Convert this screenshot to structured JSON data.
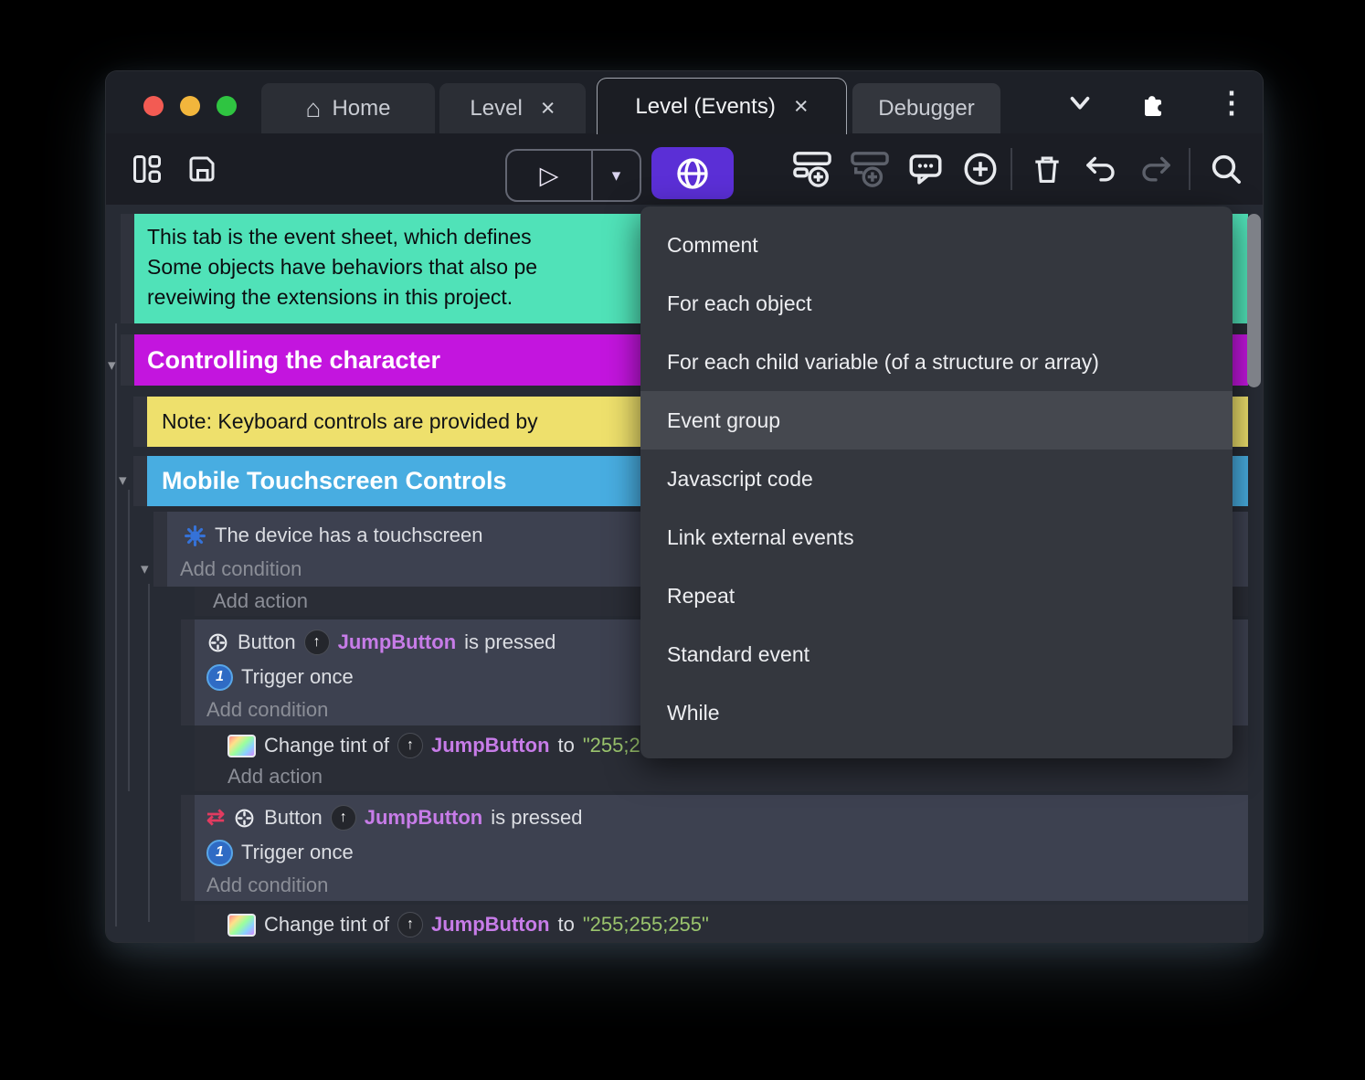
{
  "colors": {
    "accent_purple": "#5b2fd6",
    "comment_bg": "#50e2b8",
    "group_controlling_bg": "#c315de",
    "note_bg": "#eee06c",
    "group_mobile_bg": "#48ade1",
    "object_name": "#c77ce8",
    "string_value": "#9ac46d",
    "condition_block_bg": "#3d4150",
    "action_row_bg": "#2a2d36",
    "menu_bg": "#34373e",
    "menu_highlight_bg": "#45484f",
    "traffic_red": "#f35b53",
    "traffic_yellow": "#f2b63c",
    "traffic_green": "#2fc441"
  },
  "icons": {
    "house": "⌂",
    "play": "▷",
    "caret_down": "▾",
    "kebab": "⋮",
    "invert": "⇄",
    "object_arrow": "↑",
    "trigger_once_digit": "1",
    "collapse_arrow": "▾"
  },
  "titlebar": {
    "tabs": {
      "home": "Home",
      "level": "Level",
      "events": "Level (Events)",
      "debugger": "Debugger"
    },
    "close_glyph": "×"
  },
  "menu": {
    "items": [
      "Comment",
      "For each object",
      "For each child variable (of a structure or array)",
      "Event group",
      "Javascript code",
      "Link external events",
      "Repeat",
      "Standard event",
      "While"
    ],
    "highlighted_item": "Event group"
  },
  "sheet": {
    "comment_l1": "This tab is the event sheet, which defines",
    "comment_l2": "Some objects have behaviors that also pe",
    "comment_l3": "reveiwing the extensions in this project.",
    "group_controlling": "Controlling the character",
    "note": "Note: Keyboard controls are provided by",
    "group_mobile": "Mobile Touchscreen Controls",
    "device_condition": "The device has a touchscreen",
    "add_condition": "Add condition",
    "add_action": "Add action",
    "button_label": "Button",
    "object_name": "JumpButton",
    "pressed_suffix": "is pressed",
    "trigger_once": "Trigger once",
    "tint_prefix": "Change tint of",
    "to_word": "to",
    "tint_value": "\"255;255;255\""
  }
}
